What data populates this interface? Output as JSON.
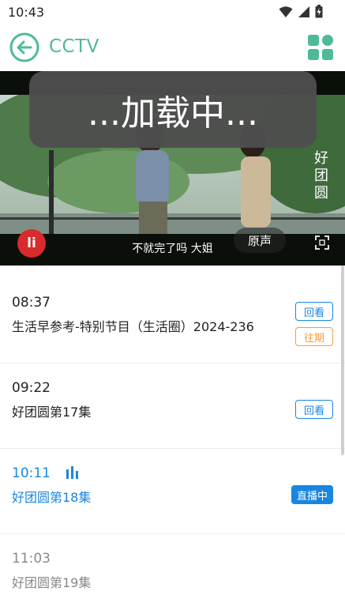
{
  "status_bar": {
    "time": "10:43",
    "icons": [
      "wifi-icon",
      "signal-icon",
      "battery-icon"
    ]
  },
  "header": {
    "title": "CCTV",
    "back_icon": "back-arrow-icon",
    "menu_icon": "grid-icon",
    "accent_color": "#4fb99a"
  },
  "player": {
    "loading_text": "...加载中...",
    "subtitle": "不就完了吗  大姐",
    "audio_button": "原声",
    "logo_text": "li",
    "watermark": "好团圆"
  },
  "programs": [
    {
      "time": "08:37",
      "title": "生活早参考-特别节目（生活圈）2024-236",
      "badges": [
        "回看",
        "往期"
      ],
      "state": "past"
    },
    {
      "time": "09:22",
      "title": "好团圆第17集",
      "badges": [
        "回看"
      ],
      "state": "past"
    },
    {
      "time": "10:11",
      "title": "好团圆第18集",
      "badges": [
        "直播中"
      ],
      "state": "live"
    },
    {
      "time": "11:03",
      "title": "好团圆第19集",
      "badges": [],
      "state": "future"
    }
  ],
  "colors": {
    "live_blue": "#1a86e0",
    "past_orange": "#f0a040"
  }
}
